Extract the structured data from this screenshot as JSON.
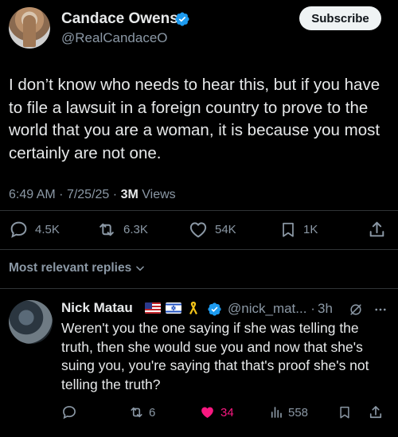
{
  "tweet": {
    "display_name": "Candace Owens",
    "handle": "@RealCandaceO",
    "subscribe_label": "Subscribe",
    "text": "I don’t know who needs to hear this, but if you have to file a lawsuit in a foreign country to prove to the world that you are a woman, it is because you most certainly are not one.",
    "time": "6:49 AM",
    "date": "7/25/25",
    "separator": "·",
    "views_count": "3M",
    "views_label": "Views",
    "replies": "4.5K",
    "reposts": "6.3K",
    "likes": "54K",
    "bookmarks": "1K",
    "icons": {
      "verified": "verified-badge-icon",
      "reply": "comment-icon",
      "repost": "repost-icon",
      "like": "heart-icon",
      "bookmark": "bookmark-icon",
      "share": "share-icon"
    }
  },
  "replies_section": {
    "sort_label": "Most relevant replies"
  },
  "reply": {
    "display_name": "Nick Matau",
    "handle": "@nick_mat...",
    "separator": "·",
    "time": "3h",
    "text": "Weren't you the one saying if she was telling the truth, then she would sue you and now that she's suing you, you're saying that that's proof she's not telling the truth?",
    "replies": "",
    "reposts": "6",
    "likes": "34",
    "views": "558",
    "liked": true,
    "emoji": [
      "us-flag",
      "israel-flag",
      "yellow-ribbon"
    ]
  },
  "colors": {
    "background": "#000000",
    "text": "#e7e9ea",
    "secondary": "#8b98a5",
    "verified": "#1d9bf0",
    "like_active": "#f91880",
    "divider": "#2f3336"
  }
}
